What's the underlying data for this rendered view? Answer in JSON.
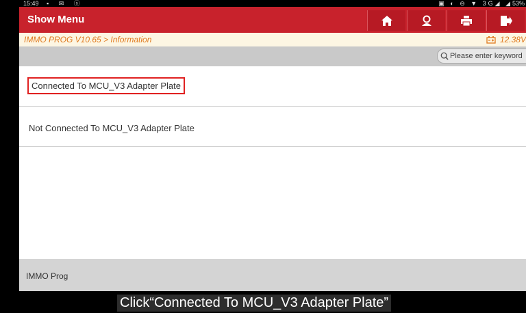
{
  "status_bar": {
    "time": "15:49",
    "battery": "53%"
  },
  "header": {
    "title": "Show Menu"
  },
  "breadcrumb": {
    "path": "IMMO PROG V10.65 > Information",
    "voltage": "12.38V"
  },
  "search": {
    "placeholder": "Please enter keyword"
  },
  "list": {
    "items": [
      {
        "label": "Connected To MCU_V3 Adapter Plate"
      },
      {
        "label": "Not Connected To MCU_V3 Adapter Plate"
      }
    ]
  },
  "footer": {
    "label": "IMMO Prog"
  },
  "caption": {
    "text": "Click“Connected To MCU_V3 Adapter Plate”"
  },
  "colors": {
    "header": "#c8222c",
    "breadcrumb_text": "#e07a1e",
    "highlight": "#e02020"
  }
}
